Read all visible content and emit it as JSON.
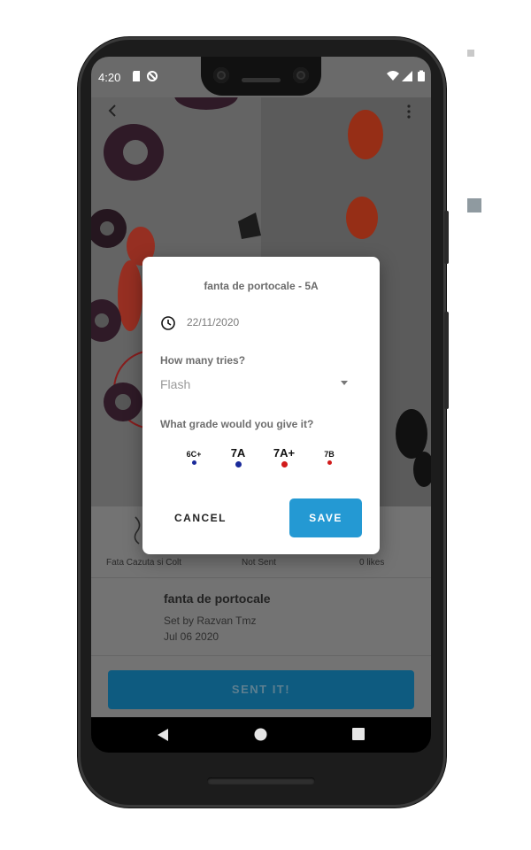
{
  "status_bar": {
    "time": "4:20"
  },
  "dialog": {
    "title": "fanta de portocale - 5A",
    "date": "22/11/2020",
    "tries_question": "How many tries?",
    "tries_value": "Flash",
    "grade_question": "What grade would you give it?",
    "grades": [
      {
        "label": "6C+",
        "dot_color": "#1a2a9a",
        "selected": false
      },
      {
        "label": "7A",
        "dot_color": "#1a2a9a",
        "selected": true
      },
      {
        "label": "7A+",
        "dot_color": "#d11b1b",
        "selected": true
      },
      {
        "label": "7B",
        "dot_color": "#d11b1b",
        "selected": false
      }
    ],
    "cancel_label": "CANCEL",
    "save_label": "SAVE"
  },
  "info": {
    "wall": "Fata Cazuta si Colt",
    "status": "Not Sent",
    "likes": "0 likes"
  },
  "route": {
    "name": "fanta de portocale",
    "setter": "Set by Razvan Tmz",
    "date": "Jul 06 2020"
  },
  "sent_button_label": "SENT IT!",
  "colors": {
    "save_button": "#2499d3",
    "sent_button": "#0e5b80",
    "grade_blue": "#1a2a9a",
    "grade_red": "#d11b1b"
  }
}
